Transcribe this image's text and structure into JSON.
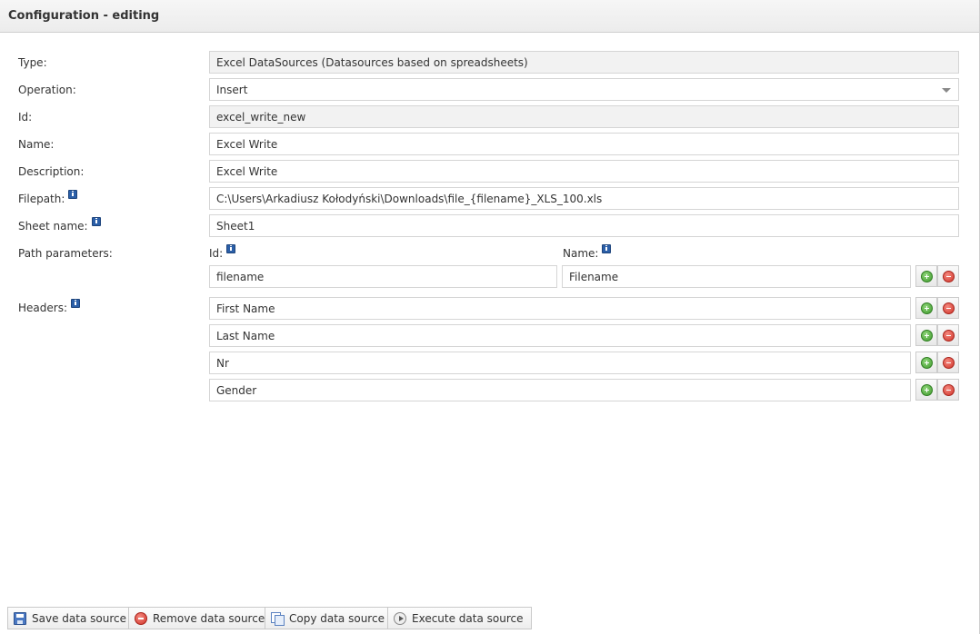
{
  "window": {
    "title": "Configuration - editing"
  },
  "form": {
    "type": {
      "label": "Type:",
      "value": "Excel DataSources (Datasources based on spreadsheets)"
    },
    "operation": {
      "label": "Operation:",
      "value": "Insert"
    },
    "id": {
      "label": "Id:",
      "value": "excel_write_new"
    },
    "name": {
      "label": "Name:",
      "value": "Excel Write"
    },
    "description": {
      "label": "Description:",
      "value": "Excel Write"
    },
    "filepath": {
      "label": "Filepath:",
      "value": "C:\\Users\\Arkadiusz Kołodyński\\Downloads\\file_{filename}_XLS_100.xls"
    },
    "sheet_name": {
      "label": "Sheet name:",
      "value": "Sheet1"
    },
    "path_parameters": {
      "label": "Path parameters:",
      "id_header": "Id:",
      "name_header": "Name:",
      "rows": [
        {
          "id": "filename",
          "name": "Filename"
        }
      ]
    },
    "headers": {
      "label": "Headers:",
      "rows": [
        "First Name",
        "Last Name",
        "Nr",
        "Gender"
      ]
    }
  },
  "footer": {
    "save": "Save data source",
    "remove": "Remove data source",
    "copy": "Copy data source",
    "execute": "Execute data source"
  },
  "colors": {
    "titlebar": "#ececec",
    "readonly_field": "#f2f2f2",
    "add_green": "#3f9a2c",
    "remove_red": "#d0342a",
    "info_blue": "#2b5fa8"
  }
}
